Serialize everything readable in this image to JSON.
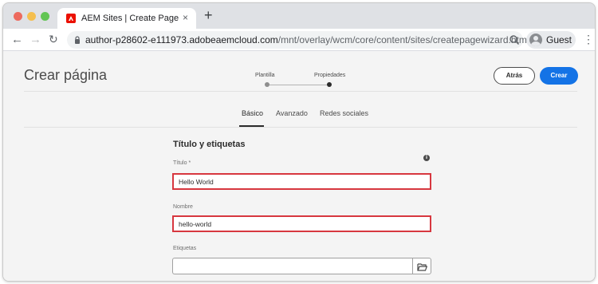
{
  "browser": {
    "tab_title": "AEM Sites | Create Page",
    "tab_close": "×",
    "new_tab": "+",
    "url_host": "author-p28602-e111973.adobeaemcloud.com",
    "url_path": "/mnt/overlay/wcm/core/content/sites/createpagewizard.html/...",
    "profile_label": "Guest",
    "favicon_color": "#eb1000"
  },
  "header": {
    "title": "Crear página",
    "steps": [
      "Plantilla",
      "Propiedades"
    ],
    "back_label": "Atrás",
    "create_label": "Crear",
    "primary_color": "#1473e6"
  },
  "tabs": [
    "Básico",
    "Avanzado",
    "Redes sociales"
  ],
  "form": {
    "section_title": "Título y etiquetas",
    "info_icon": "i",
    "title_label": "Título *",
    "title_value": "Hello World",
    "name_label": "Nombre",
    "name_value": "hello-world",
    "tags_label": "Etiquetas",
    "tags_value": "",
    "highlight_color": "#d7373f"
  }
}
